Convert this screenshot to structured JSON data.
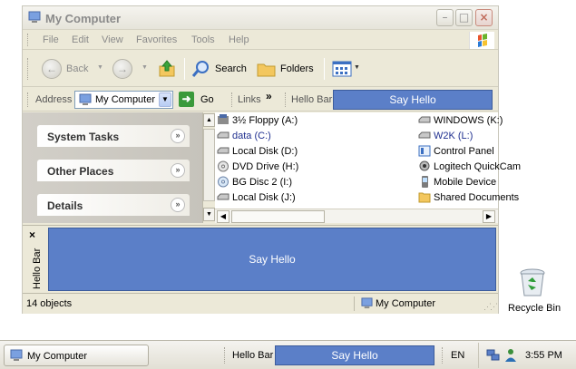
{
  "window": {
    "title": "My Computer",
    "menu": [
      "File",
      "Edit",
      "View",
      "Favorites",
      "Tools",
      "Help"
    ]
  },
  "toolbar": {
    "back_label": "Back",
    "search_label": "Search",
    "folders_label": "Folders"
  },
  "addressbar": {
    "label": "Address",
    "value": "My Computer",
    "go_label": "Go",
    "links_label": "Links",
    "links_chevron": "»",
    "hello_bar_label": "Hello Bar",
    "say_hello_label": "Say Hello"
  },
  "taskpane": {
    "sections": [
      "System Tasks",
      "Other Places",
      "Details"
    ]
  },
  "files": {
    "left": [
      {
        "name": "3½ Floppy (A:)",
        "icon": "floppy-icon"
      },
      {
        "name": "data (C:)",
        "icon": "disk-icon"
      },
      {
        "name": "Local Disk (D:)",
        "icon": "disk-icon"
      },
      {
        "name": "DVD Drive (H:)",
        "icon": "dvd-icon"
      },
      {
        "name": "BG Disc 2 (I:)",
        "icon": "cd-icon"
      },
      {
        "name": "Local Disk (J:)",
        "icon": "disk-icon"
      }
    ],
    "right": [
      {
        "name": "WINDOWS (K:)",
        "icon": "disk-icon"
      },
      {
        "name": "W2K (L:)",
        "icon": "disk-icon"
      },
      {
        "name": "Control Panel",
        "icon": "control-panel-icon"
      },
      {
        "name": "Logitech QuickCam",
        "icon": "camera-icon"
      },
      {
        "name": "Mobile Device",
        "icon": "mobile-icon"
      },
      {
        "name": "Shared Documents",
        "icon": "folder-icon"
      }
    ]
  },
  "hellobar": {
    "vertical_label": "Hello Bar",
    "close_glyph": "×",
    "button_label": "Say Hello"
  },
  "statusbar": {
    "objects": "14 objects",
    "location": "My Computer"
  },
  "desktop": {
    "recycle_label": "Recycle Bin"
  },
  "taskbar": {
    "window_label": "My Computer",
    "hello_bar_label": "Hello Bar",
    "say_hello_label": "Say Hello",
    "language": "EN",
    "time": "3:55 PM"
  },
  "colors": {
    "accent": "#5b7fc8",
    "window_bg": "#ece9d8"
  }
}
